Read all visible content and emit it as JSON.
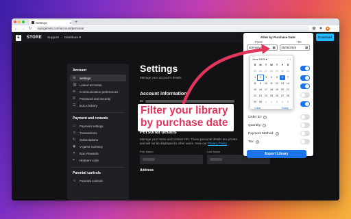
{
  "browser": {
    "tab_title": "Settings",
    "url": "epicgames.com/account/personal",
    "new_tab": "+",
    "dots": [
      "#ff5f57",
      "#febc2e",
      "#28c840"
    ]
  },
  "nav": {
    "logo": "E",
    "store": "STORE",
    "links": [
      "Support",
      "Distribute"
    ],
    "download": "Download"
  },
  "sidebar": {
    "sections": [
      {
        "title": "Account",
        "items": [
          "Settings",
          "Linked accounts",
          "Communication preferences",
          "Password and security",
          "EULA history"
        ]
      },
      {
        "title": "Payment and rewards",
        "items": [
          "Payment settings",
          "Transactions",
          "Subscriptions",
          "V-game currency",
          "Epic Rewards",
          "Redeem code"
        ]
      },
      {
        "title": "Parental controls",
        "items": [
          "Parental controls"
        ]
      }
    ]
  },
  "main": {
    "title": "Settings",
    "subtitle": "Manage your account's details",
    "account_info": "Account information",
    "id_label": "ID:",
    "personal_title": "Personal details",
    "personal_text": "Manage your name and contact info. These personal details are private and will not be displayed to other users. View our",
    "privacy": "Privacy Policy",
    "first_name": "First Name",
    "last_name": "Last Name",
    "address": "Address"
  },
  "popup": {
    "title": "Filter by Purchase Date:",
    "from": "From:",
    "to": "To:",
    "from_value": "dd/mm/yyyy",
    "to_value": "06/06/2025",
    "rows": [
      {
        "label": "Order ID:",
        "on": false
      },
      {
        "label": "Quantity:",
        "on": false
      },
      {
        "label": "Payment Method:",
        "on": false
      },
      {
        "label": "Tax:",
        "on": false
      }
    ],
    "export": "Export Library"
  },
  "calendar": {
    "month": "June 2025",
    "days": [
      "S",
      "M",
      "T",
      "W",
      "T",
      "F",
      "S"
    ],
    "dates": [
      "25",
      "26",
      "27",
      "28",
      "29",
      "30",
      "31",
      "1",
      "2",
      "3",
      "4",
      "5",
      "6",
      "7",
      "8",
      "9",
      "10",
      "11",
      "12",
      "13",
      "14",
      "15",
      "16",
      "17",
      "18",
      "19",
      "20",
      "21",
      "22",
      "23",
      "24",
      "25",
      "26",
      "27",
      "28",
      "29",
      "30",
      "1",
      "2",
      "3",
      "4",
      "5"
    ],
    "clear": "Clear",
    "today": "Today"
  },
  "callout": {
    "line1": "Filter your library",
    "line2": "by purchase date"
  },
  "colors": {
    "accent": "#26bbff",
    "toggle_on": "#1a73e8",
    "callout": "#e1355b"
  }
}
